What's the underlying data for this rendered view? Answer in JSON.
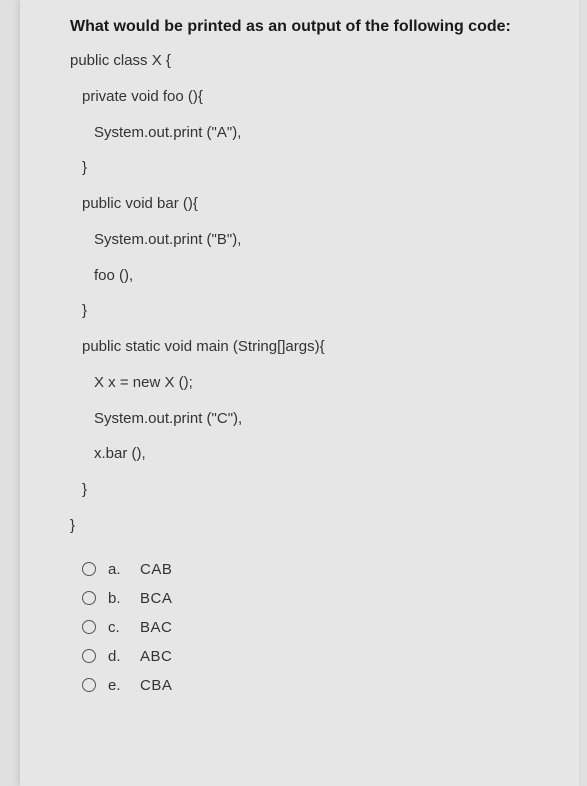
{
  "question": "What would be printed as an output of the following code:",
  "code": {
    "l1": "public class X {",
    "l2": "private void foo (){",
    "l3": "System.out.print (\"A\"),",
    "l4": "}",
    "l5": "public void bar (){",
    "l6": "System.out.print (\"B\"),",
    "l7": "foo (),",
    "l8": "}",
    "l9": "public static void main (String[]args){",
    "l10": "X x = new X ();",
    "l11": "System.out.print (\"C\"),",
    "l12": "x.bar (),",
    "l13": "}",
    "l14": "}"
  },
  "options": [
    {
      "letter": "a.",
      "text": "CAB"
    },
    {
      "letter": "b.",
      "text": "BCA"
    },
    {
      "letter": "c.",
      "text": "BAC"
    },
    {
      "letter": "d.",
      "text": "ABC"
    },
    {
      "letter": "e.",
      "text": "CBA"
    }
  ]
}
